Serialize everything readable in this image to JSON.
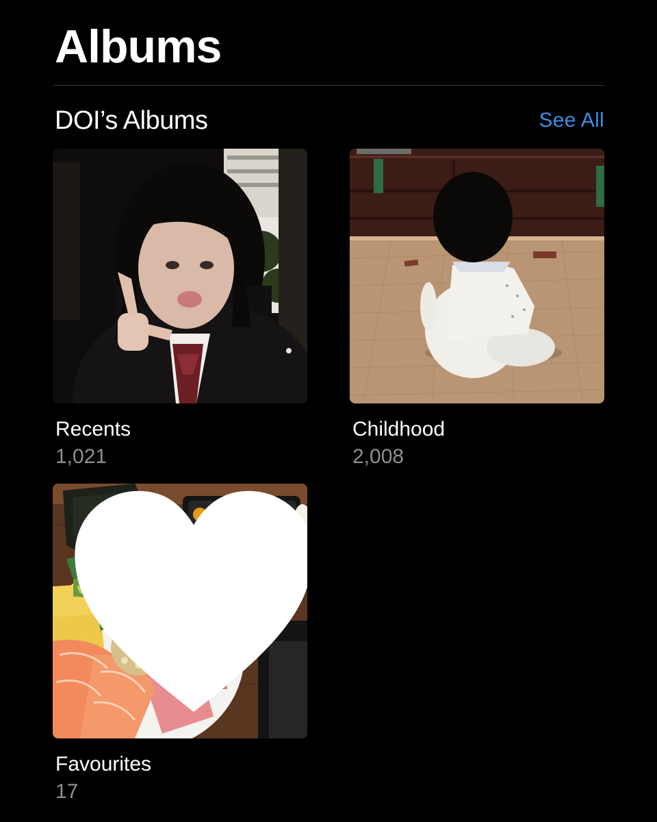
{
  "page": {
    "title": "Albums"
  },
  "section": {
    "title": "DOI’s Albums",
    "see_all_label": "See All"
  },
  "albums": [
    {
      "name": "Recents",
      "count": "1,021",
      "thumbnail": "photo-girl-peace-sign"
    },
    {
      "name": "Childhood",
      "count": "2,008",
      "thumbnail": "photo-child-on-wood-floor"
    },
    {
      "name": "Favourites",
      "count": "17",
      "thumbnail": "photo-sashimi-bowl",
      "badge_icon": "heart-icon"
    }
  ],
  "colors": {
    "background": "#000000",
    "accent": "#3a8ee6",
    "secondary_text": "#8e8e93"
  }
}
